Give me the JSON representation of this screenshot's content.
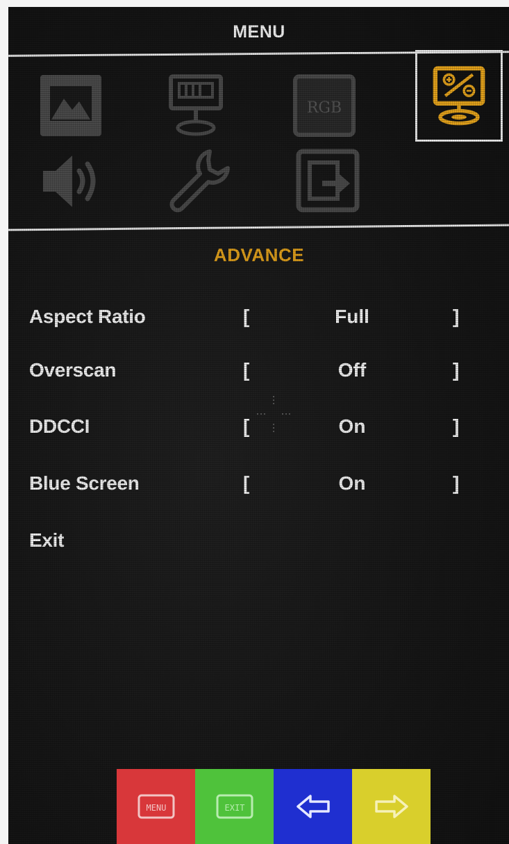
{
  "header": {
    "title": "MENU"
  },
  "icons": [
    {
      "name": "picture-icon",
      "selected": false
    },
    {
      "name": "display-icon",
      "selected": false
    },
    {
      "name": "rgb-icon",
      "label": "RGB",
      "selected": false
    },
    {
      "name": "advance-icon",
      "selected": true
    },
    {
      "name": "audio-icon",
      "selected": false
    },
    {
      "name": "wrench-icon",
      "selected": false
    },
    {
      "name": "input-icon",
      "selected": false
    }
  ],
  "section": {
    "title": "ADVANCE"
  },
  "settings": [
    {
      "label": "Aspect Ratio",
      "left_bracket": "[",
      "value": "Full",
      "right_bracket": "]"
    },
    {
      "label": "Overscan",
      "left_bracket": "[",
      "value": "Off",
      "right_bracket": "]"
    },
    {
      "label": "DDCCI",
      "left_bracket": "[",
      "value": "On",
      "right_bracket": "]"
    },
    {
      "label": "Blue Screen",
      "left_bracket": "[",
      "value": "On",
      "right_bracket": "]"
    }
  ],
  "exit": {
    "label": "Exit"
  },
  "keys": [
    {
      "name": "menu-key",
      "label": "MENU",
      "color": "#d8373a"
    },
    {
      "name": "exit-key",
      "label": "EXIT",
      "color": "#4fc23b"
    },
    {
      "name": "left-arrow-key",
      "color": "#1f2fd0"
    },
    {
      "name": "right-arrow-key",
      "color": "#d9cf2c"
    }
  ],
  "colors": {
    "accent": "#e3a21c",
    "icon_inactive": "#4a4a4a",
    "text": "#f1f1f1"
  }
}
